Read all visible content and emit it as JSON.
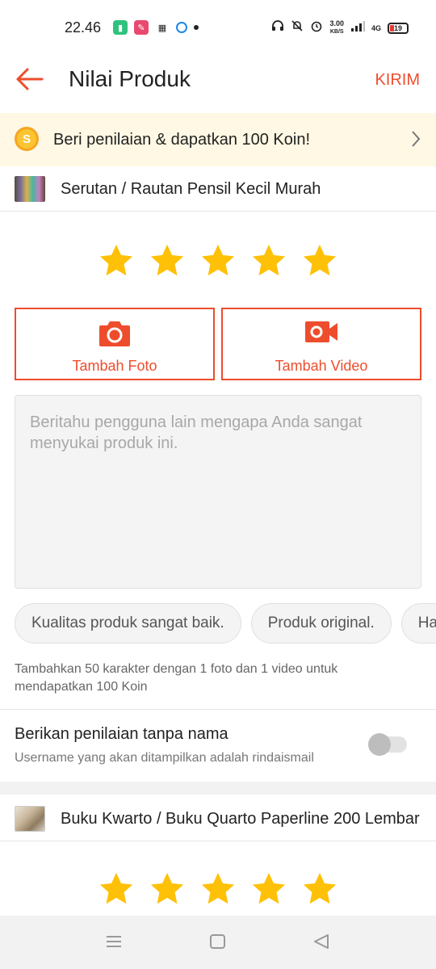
{
  "status_bar": {
    "time": "22.46",
    "speed_value": "3.00",
    "speed_unit": "KB/S",
    "network": "4G",
    "battery": "19"
  },
  "header": {
    "title": "Nilai Produk",
    "submit_label": "KIRIM"
  },
  "banner": {
    "coin_symbol": "S",
    "text": "Beri penilaian & dapatkan 100 Koin!"
  },
  "products": [
    {
      "name": "Serutan / Rautan Pensil Kecil Murah",
      "rating": 5
    },
    {
      "name": "Buku Kwarto / Buku Quarto Paperline 200 Lembar",
      "rating": 5
    }
  ],
  "media": {
    "photo_label": "Tambah Foto",
    "video_label": "Tambah Video"
  },
  "review": {
    "placeholder": "Beritahu pengguna lain mengapa Anda sangat menyukai produk ini."
  },
  "chips": [
    "Kualitas produk sangat baik.",
    "Produk original.",
    "Harga terjangkau."
  ],
  "hint": "Tambahkan 50 karakter dengan 1 foto dan 1 video untuk mendapatkan 100 Koin",
  "anonymous": {
    "title": "Berikan penilaian tanpa nama",
    "subtitle": "Username yang akan ditampilkan adalah rindaismail",
    "enabled": false
  },
  "colors": {
    "accent": "#ee4d2d",
    "star": "#ffc107",
    "banner_bg": "#fff8e4"
  }
}
